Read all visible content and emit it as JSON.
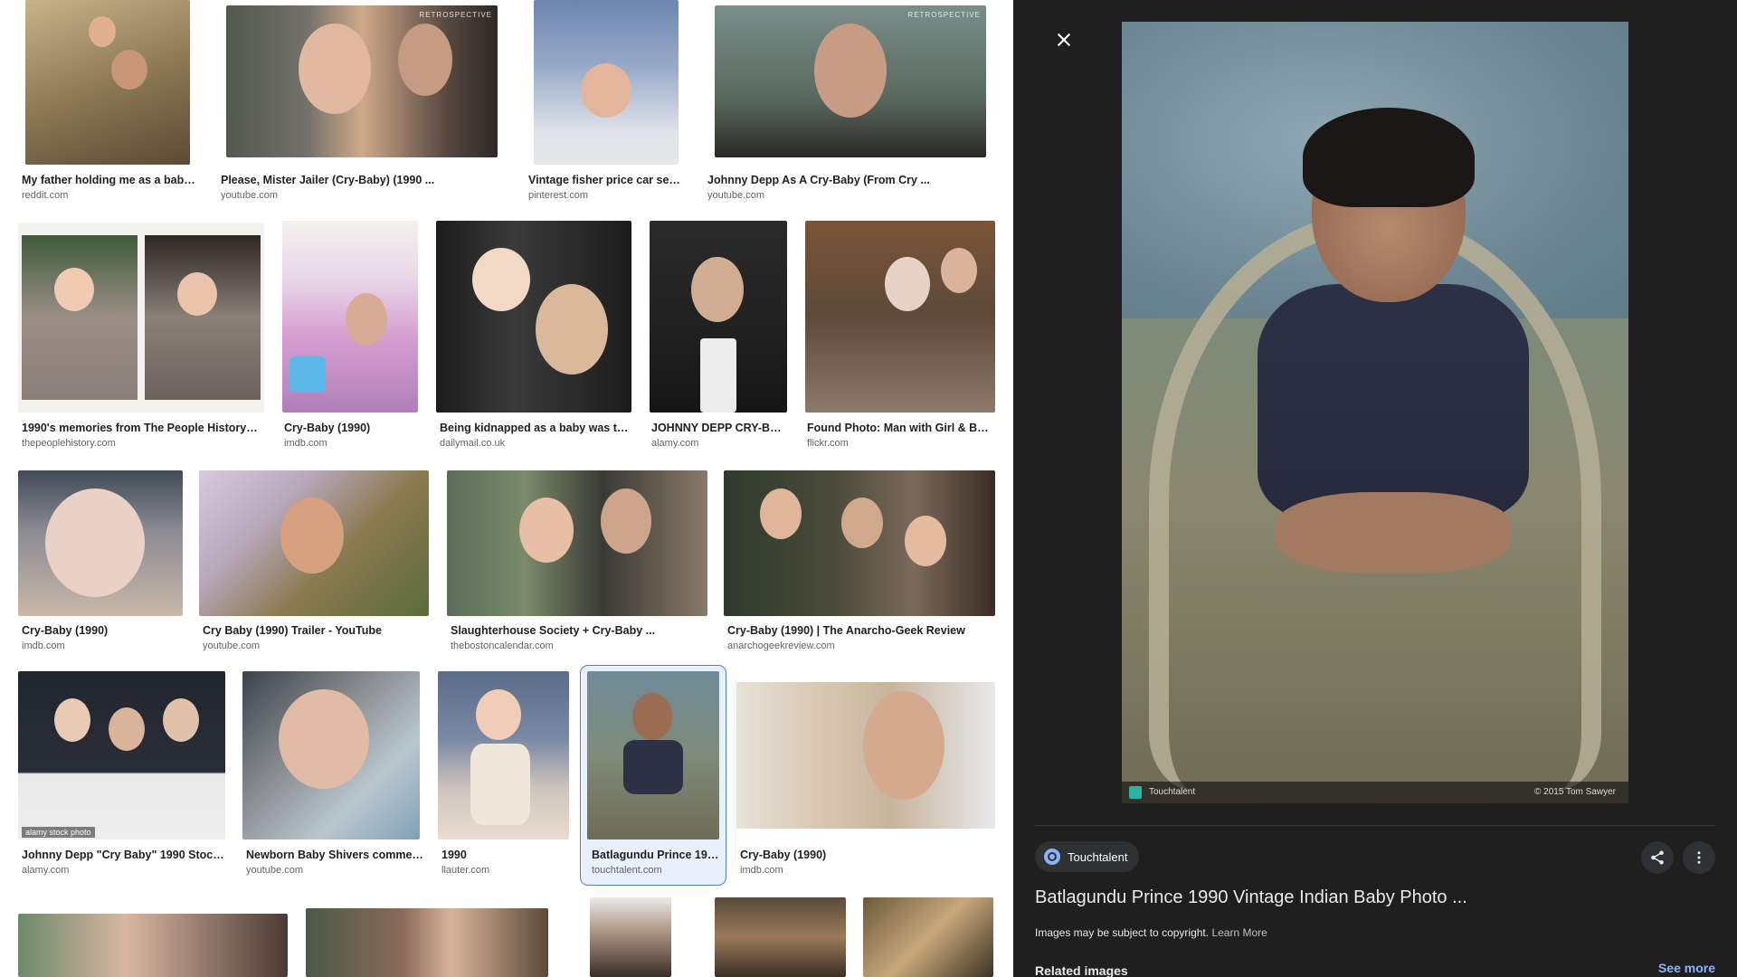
{
  "results": [
    {
      "title": "My father holding me as a baby 1...",
      "source": "reddit.com"
    },
    {
      "title": "Please, Mister Jailer (Cry-Baby) (1990 ...",
      "source": "youtube.com"
    },
    {
      "title": "Vintage fisher price car seat ...",
      "source": "pinterest.com"
    },
    {
      "title": "Johnny Depp As A Cry-Baby (From Cry ...",
      "source": "youtube.com"
    },
    {
      "title": "1990's memories from The People History ...",
      "source": "thepeoplehistory.com"
    },
    {
      "title": "Cry-Baby (1990)",
      "source": "imdb.com"
    },
    {
      "title": "Being kidnapped as a baby was the ...",
      "source": "dailymail.co.uk"
    },
    {
      "title": "JOHNNY DEPP CRY-BA...",
      "source": "alamy.com"
    },
    {
      "title": "Found Photo: Man with Girl & Baby...",
      "source": "flickr.com"
    },
    {
      "title": "Cry-Baby (1990)",
      "source": "imdb.com"
    },
    {
      "title": "Cry Baby (1990) Trailer - YouTube",
      "source": "youtube.com"
    },
    {
      "title": "Slaughterhouse Society + Cry-Baby ...",
      "source": "thebostoncalendar.com"
    },
    {
      "title": "Cry-Baby (1990) | The Anarcho-Geek Review",
      "source": "anarchogeekreview.com"
    },
    {
      "title": "Johnny Depp \"Cry Baby\" 1990 Stock P...",
      "source": "alamy.com"
    },
    {
      "title": "Newborn Baby Shivers commer...",
      "source": "youtube.com"
    },
    {
      "title": "1990",
      "source": "llauter.com"
    },
    {
      "title": "Batlagundu Prince 199...",
      "source": "touchtalent.com"
    },
    {
      "title": "Cry-Baby (1990)",
      "source": "imdb.com"
    }
  ],
  "watermarks": {
    "retrospective": "RETROSPECTIVE",
    "alamy": "alamy stock photo"
  },
  "viewer": {
    "image_brand": "Touchtalent",
    "image_copyright": "© 2015 Tom Sawyer",
    "source_chip": "Touchtalent",
    "title": "Batlagundu Prince 1990 Vintage Indian Baby Photo ...",
    "copyright_notice": "Images may be subject to copyright.",
    "learn_more": "Learn More",
    "related_heading": "Related images",
    "see_more": "See more",
    "share_icon": "share-icon",
    "more_icon": "more-vert-icon",
    "close_icon": "close-icon"
  },
  "colors": {
    "viewer_bg": "#1f1f1f",
    "link_blue": "#8ab4f8",
    "selected_outline": "#4a80d8"
  }
}
